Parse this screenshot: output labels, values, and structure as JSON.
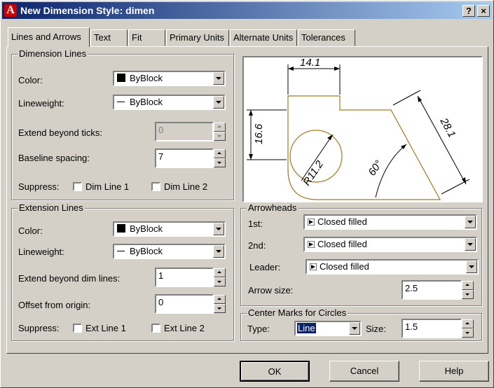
{
  "window": {
    "title": "New Dimension Style: dimen",
    "help_btn": "?",
    "close_btn": "×"
  },
  "tabs": [
    "Lines and Arrows",
    "Text",
    "Fit",
    "Primary Units",
    "Alternate Units",
    "Tolerances"
  ],
  "dimension_lines": {
    "group_label": "Dimension Lines",
    "color_label": "Color:",
    "color_value": "ByBlock",
    "lineweight_label": "Lineweight:",
    "lineweight_value": "ByBlock",
    "extend_label": "Extend beyond ticks:",
    "extend_value": "0",
    "baseline_label": "Baseline spacing:",
    "baseline_value": "7",
    "suppress_label": "Suppress:",
    "dim_line_1": "Dim Line 1",
    "dim_line_2": "Dim Line 2"
  },
  "extension_lines": {
    "group_label": "Extension Lines",
    "color_label": "Color:",
    "color_value": "ByBlock",
    "lineweight_label": "Lineweight:",
    "lineweight_value": "ByBlock",
    "extend_label": "Extend beyond dim lines:",
    "extend_value": "1",
    "offset_label": "Offset from origin:",
    "offset_value": "0",
    "suppress_label": "Suppress:",
    "ext_line_1": "Ext Line 1",
    "ext_line_2": "Ext Line 2"
  },
  "preview": {
    "dim_top": "14.1",
    "dim_left": "16.6",
    "dim_right": "28.1",
    "dim_radius": "R11.2",
    "dim_angle": "60°"
  },
  "arrowheads": {
    "group_label": "Arrowheads",
    "first_label": "1st:",
    "first_value": "Closed filled",
    "second_label": "2nd:",
    "second_value": "Closed filled",
    "leader_label": "Leader:",
    "leader_value": "Closed filled",
    "size_label": "Arrow size:",
    "size_value": "2.5"
  },
  "center_marks": {
    "group_label": "Center Marks for Circles",
    "type_label": "Type:",
    "type_value": "Line",
    "size_label": "Size:",
    "size_value": "1.5"
  },
  "buttons": {
    "ok": "OK",
    "cancel": "Cancel",
    "help": "Help"
  },
  "colors": {
    "titlebar": "#0a246a",
    "face": "#d4d0c8",
    "geometry": "#a07a1e"
  }
}
